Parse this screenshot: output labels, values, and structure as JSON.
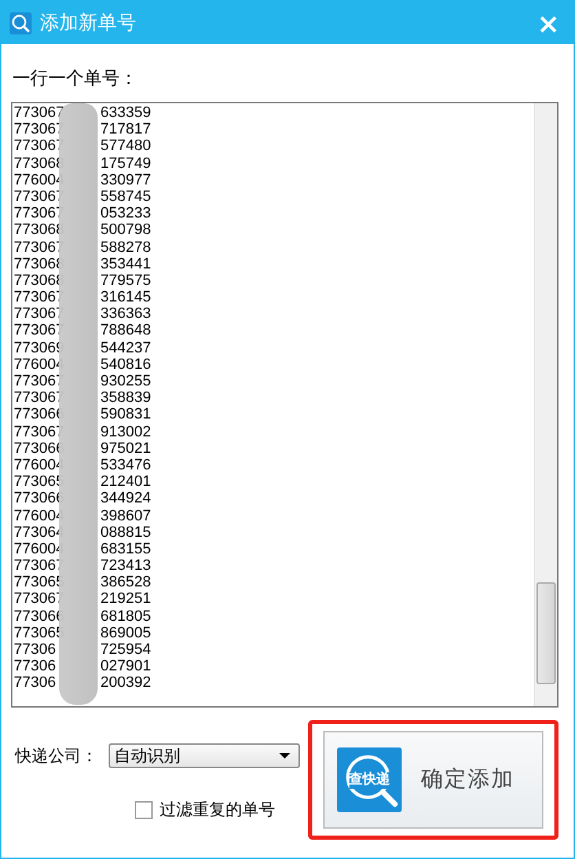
{
  "window": {
    "title": "添加新单号",
    "close": "×"
  },
  "list_label": "一行一个单号：",
  "numbers": [
    {
      "prefix": "773067",
      "suffix": "633359"
    },
    {
      "prefix": "773067",
      "suffix": "717817"
    },
    {
      "prefix": "773067",
      "suffix": "577480"
    },
    {
      "prefix": "773068",
      "suffix": "175749"
    },
    {
      "prefix": "776004",
      "suffix": "330977"
    },
    {
      "prefix": "773067",
      "suffix": "558745"
    },
    {
      "prefix": "773067",
      "suffix": "053233"
    },
    {
      "prefix": "773068",
      "suffix": "500798"
    },
    {
      "prefix": "773067",
      "suffix": "588278"
    },
    {
      "prefix": "773068",
      "suffix": "353441"
    },
    {
      "prefix": "773068",
      "suffix": "779575"
    },
    {
      "prefix": "773067",
      "suffix": "316145"
    },
    {
      "prefix": "773067",
      "suffix": "336363"
    },
    {
      "prefix": "773067",
      "suffix": "788648"
    },
    {
      "prefix": "773069",
      "suffix": "544237"
    },
    {
      "prefix": "776004",
      "suffix": "540816"
    },
    {
      "prefix": "773067",
      "suffix": "930255"
    },
    {
      "prefix": "773067",
      "suffix": "358839"
    },
    {
      "prefix": "773066",
      "suffix": "590831"
    },
    {
      "prefix": "773067",
      "suffix": "913002"
    },
    {
      "prefix": "773066",
      "suffix": "975021"
    },
    {
      "prefix": "776004",
      "suffix": "533476"
    },
    {
      "prefix": "773065",
      "suffix": "212401"
    },
    {
      "prefix": "773066",
      "suffix": "344924"
    },
    {
      "prefix": "776004",
      "suffix": "398607"
    },
    {
      "prefix": "773064",
      "suffix": "088815"
    },
    {
      "prefix": "776004",
      "suffix": "683155"
    },
    {
      "prefix": "773067",
      "suffix": "723413"
    },
    {
      "prefix": "773065",
      "suffix": "386528"
    },
    {
      "prefix": "773067",
      "suffix": "219251"
    },
    {
      "prefix": "773066",
      "suffix": "681805"
    },
    {
      "prefix": "773065",
      "suffix": "869005"
    },
    {
      "prefix": "77306",
      "suffix": "725954"
    },
    {
      "prefix": "77306",
      "suffix": "027901"
    },
    {
      "prefix": "77306",
      "suffix": "200392"
    }
  ],
  "company": {
    "label": "快递公司：",
    "value": "自动识别"
  },
  "filter_duplicates": {
    "label": "过滤重复的单号",
    "checked": false
  },
  "confirm_button": {
    "icon_text": "查快递",
    "label": "确定添加",
    "highlighted": true
  }
}
